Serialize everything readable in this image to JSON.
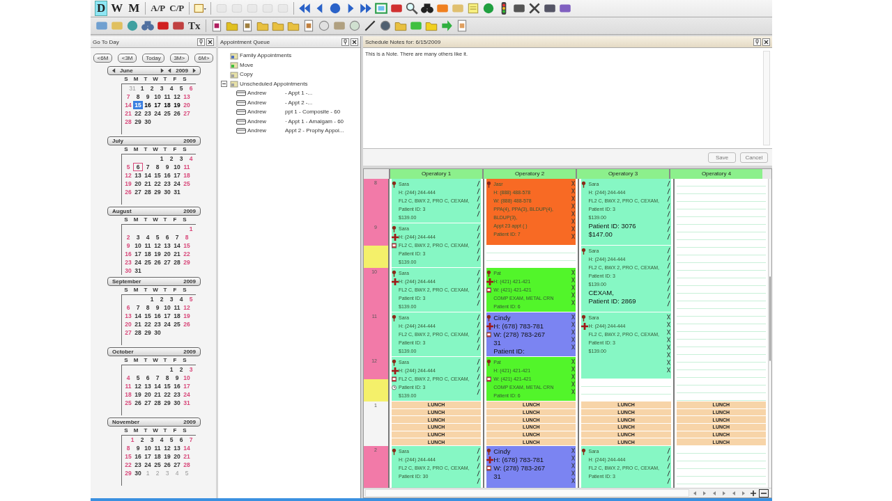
{
  "toolbar": {
    "view_buttons": [
      {
        "label": "D",
        "selected": true
      },
      {
        "label": "W",
        "selected": false
      },
      {
        "label": "M",
        "selected": false
      }
    ],
    "text_buttons": [
      "A/P",
      "C/P"
    ],
    "tx_button": "Tx",
    "edit_tools_disabled": true
  },
  "go_to_day": {
    "title": "Go To Day",
    "jump_buttons": [
      "<6M",
      "<3M",
      "Today",
      "3M>",
      "6M>"
    ],
    "months": [
      {
        "name": "June",
        "year": "2009",
        "nav": true,
        "weekdays": [
          "S",
          "M",
          "T",
          "W",
          "T",
          "F",
          "S"
        ],
        "weeks": [
          [
            {
              "day": "31",
              "outside": true
            },
            "1",
            "2",
            "3",
            "4",
            "5",
            "6"
          ],
          [
            "7",
            "8",
            "9",
            "10",
            "11",
            "12",
            "13"
          ],
          [
            "14",
            {
              "day": "15",
              "selected": true
            },
            {
              "day": "16",
              "bold": true
            },
            {
              "day": "17",
              "bold": true
            },
            {
              "day": "18",
              "bold": true
            },
            {
              "day": "19",
              "bold": true
            },
            "20"
          ],
          [
            "21",
            "22",
            "23",
            "24",
            "25",
            "26",
            "27"
          ],
          [
            "28",
            "29",
            "30"
          ]
        ]
      },
      {
        "name": "July",
        "year": "2009",
        "nav": false,
        "weekdays": [
          "S",
          "M",
          "T",
          "W",
          "T",
          "F",
          "S"
        ],
        "weeks": [
          [
            "1",
            "2",
            "3",
            "4"
          ],
          [
            "5",
            {
              "day": "6",
              "today": true
            },
            "7",
            "8",
            "9",
            "10",
            "11"
          ],
          [
            "12",
            "13",
            "14",
            "15",
            "16",
            "17",
            "18"
          ],
          [
            "19",
            "20",
            "21",
            "22",
            "23",
            "24",
            "25"
          ],
          [
            "26",
            "27",
            "28",
            "29",
            "30",
            "31"
          ]
        ]
      },
      {
        "name": "August",
        "year": "2009",
        "nav": false,
        "weekdays": [
          "S",
          "M",
          "T",
          "W",
          "T",
          "F",
          "S"
        ],
        "weeks": [
          [
            "1"
          ],
          [
            "2",
            "3",
            "4",
            "5",
            "6",
            "7",
            "8"
          ],
          [
            "9",
            "10",
            "11",
            "12",
            "13",
            "14",
            "15"
          ],
          [
            "16",
            "17",
            "18",
            "19",
            "20",
            "21",
            "22"
          ],
          [
            "23",
            "24",
            "25",
            "26",
            "27",
            "28",
            "29"
          ],
          [
            "30",
            "31"
          ]
        ]
      },
      {
        "name": "September",
        "year": "2009",
        "nav": false,
        "weekdays": [
          "S",
          "M",
          "T",
          "W",
          "T",
          "F",
          "S"
        ],
        "weeks": [
          [
            "1",
            "2",
            "3",
            "4",
            "5"
          ],
          [
            "6",
            "7",
            "8",
            "9",
            "10",
            "11",
            "12"
          ],
          [
            "13",
            "14",
            "15",
            "16",
            "17",
            "18",
            "19"
          ],
          [
            "20",
            "21",
            "22",
            "23",
            "24",
            "25",
            "26"
          ],
          [
            "27",
            "28",
            "29",
            "30"
          ]
        ]
      },
      {
        "name": "October",
        "year": "2009",
        "nav": false,
        "weekdays": [
          "S",
          "M",
          "T",
          "W",
          "T",
          "F",
          "S"
        ],
        "weeks": [
          [
            "1",
            "2",
            "3"
          ],
          [
            "4",
            "5",
            "6",
            "7",
            "8",
            "9",
            "10"
          ],
          [
            "11",
            "12",
            "13",
            "14",
            "15",
            "16",
            "17"
          ],
          [
            "18",
            "19",
            "20",
            "21",
            "22",
            "23",
            "24"
          ],
          [
            "25",
            "26",
            "27",
            "28",
            "29",
            "30",
            "31"
          ]
        ]
      },
      {
        "name": "November",
        "year": "2009",
        "nav": false,
        "weekdays": [
          "S",
          "M",
          "T",
          "W",
          "T",
          "F",
          "S"
        ],
        "weeks": [
          [
            "1",
            "2",
            "3",
            "4",
            "5",
            "6",
            "7"
          ],
          [
            "8",
            "9",
            "10",
            "11",
            "12",
            "13",
            "14"
          ],
          [
            "15",
            "16",
            "17",
            "18",
            "19",
            "20",
            "21"
          ],
          [
            "22",
            "23",
            "24",
            "25",
            "26",
            "27",
            "28"
          ],
          [
            "29",
            "30",
            {
              "day": "1",
              "outside": true
            },
            {
              "day": "2",
              "outside": true
            },
            {
              "day": "3",
              "outside": true
            },
            {
              "day": "4",
              "outside": true
            },
            {
              "day": "5",
              "outside": true
            }
          ]
        ]
      }
    ]
  },
  "appointment_queue": {
    "title": "Appointment Queue",
    "items": [
      {
        "label": "Family Appointments"
      },
      {
        "label": "Move"
      },
      {
        "label": "Copy"
      },
      {
        "label": "Unscheduled Appointments",
        "expanded": true,
        "children": [
          {
            "patient": "Andrew",
            "appointment": "- Appt 1 -..."
          },
          {
            "patient": "Andrew",
            "appointment": "- Appt 2 -..."
          },
          {
            "patient": "Andrew",
            "appointment": "ppt 1 - Composite - 60"
          },
          {
            "patient": "Andrew",
            "appointment": "· Appt 1 - Amalgam - 60"
          },
          {
            "patient": "Andrew",
            "appointment": "Appt 2 - Prophy Appoi..."
          }
        ]
      }
    ]
  },
  "schedule_notes": {
    "title": "Schedule Notes for: 6/15/2009",
    "text": "This is a Note.  There are many others like it.",
    "buttons": [
      {
        "label": "Save",
        "disabled": true
      },
      {
        "label": "Cancel",
        "disabled": true
      }
    ]
  },
  "schedule": {
    "time_segments": [
      {
        "color": "#f27aa8"
      },
      {
        "color": "#f4f06a"
      },
      {
        "color": "#f27aa8"
      },
      {
        "color": "#f4f06a"
      },
      {
        "color": "#f4f4f4"
      },
      {
        "color": "#f27aa8"
      }
    ],
    "hours": [
      "8",
      "9",
      "10",
      "11",
      "12",
      "1",
      "2"
    ],
    "operatories": [
      {
        "name": "Operatory 1",
        "blocks": [
          {
            "kind": "appointment",
            "color": "#86f7c4",
            "cross_marks": false,
            "alert": false,
            "note": false,
            "clock": false,
            "large": false,
            "lines": [
              "Sara",
              "H: (244) 244-444",
              "FL2 C, BWX 2, PRO C, CEXAM,",
              "Patient ID: 3",
              "$139.00"
            ]
          },
          {
            "kind": "appointment",
            "color": "#86f7c4",
            "cross_marks": false,
            "alert": true,
            "note": true,
            "clock": false,
            "large": false,
            "lines": [
              "Sara",
              "H: (244) 244-444",
              "FL2 C, BWX 2, PRO C, CEXAM,",
              "Patient ID: 3",
              "$139.00"
            ]
          },
          {
            "kind": "appointment",
            "color": "#86f7c4",
            "cross_marks": false,
            "alert": true,
            "note": false,
            "clock": false,
            "large": false,
            "lines": [
              "Sara",
              "H: (244) 244-444",
              "FL2 C, BWX 2, PRO C, CEXAM,",
              "Patient ID: 3",
              "$139.00"
            ]
          },
          {
            "kind": "appointment",
            "color": "#86f7c4",
            "cross_marks": false,
            "alert": false,
            "note": false,
            "clock": false,
            "large": false,
            "lines": [
              "Sara",
              "H: (244) 244-444",
              "FL2 C, BWX 2, PRO C, CEXAM,",
              "Patient ID: 3",
              "$139.00"
            ]
          },
          {
            "kind": "appointment",
            "color": "#86f7c4",
            "cross_marks": false,
            "alert": true,
            "note": true,
            "clock": true,
            "large": false,
            "lines": [
              "Sara",
              "H: (244) 244-444",
              "FL2 C, BWX 2, PRO C, CEXAM,",
              "Patient ID: 3",
              "$139.00"
            ]
          },
          {
            "kind": "lunch",
            "lines": [
              "LUNCH",
              "LUNCH",
              "LUNCH",
              "LUNCH",
              "LUNCH",
              "LUNCH"
            ]
          },
          {
            "kind": "appointment",
            "color": "#86f7c4",
            "cross_marks": false,
            "alert": false,
            "note": false,
            "clock": false,
            "large": false,
            "lines": [
              "Sara",
              "H: (244) 244-444",
              "FL2 C, BWX 2, PRO C, CEXAM,",
              "Patient ID: 30"
            ]
          }
        ]
      },
      {
        "name": "Operatory 2",
        "blocks": [
          {
            "kind": "appointment",
            "color": "#f86a24",
            "cross_marks": true,
            "alert": false,
            "note": false,
            "clock": false,
            "large": false,
            "lines": [
              "Jasr",
              "H: (888) 488-578",
              "W: (888) 488-578",
              "PPA(4), PPA(3), BLDUP(4), BLDUP(3),",
              "Appt 23 appt ( )",
              "Patient ID: 7"
            ]
          },
          {
            "kind": "empty"
          },
          {
            "kind": "appointment",
            "color": "#52f52a",
            "cross_marks": true,
            "alert": true,
            "note": true,
            "clock": false,
            "large": false,
            "lines": [
              "Pat",
              "H: (421) 421-421",
              "W: (421) 421-421",
              "COMP EXAM, METAL CRN",
              "Patient ID: 6"
            ]
          },
          {
            "kind": "appointment",
            "color": "#7b84f2",
            "cross_marks": true,
            "alert": true,
            "note": true,
            "clock": false,
            "large": true,
            "lines": [
              "Cindy",
              "H: (678) 783-781",
              "W: (278) 783-267",
              "31",
              "Patient ID:"
            ]
          },
          {
            "kind": "appointment",
            "color": "#52f52a",
            "cross_marks": true,
            "alert": false,
            "note": true,
            "clock": false,
            "large": false,
            "lines": [
              "Pat",
              "H: (421) 421-421",
              "W: (421) 421-421",
              "COMP EXAM, METAL CRN",
              "Patient ID: 6"
            ]
          },
          {
            "kind": "lunch",
            "lines": [
              "LUNCH",
              "LUNCH",
              "LUNCH",
              "LUNCH",
              "LUNCH",
              "LUNCH"
            ]
          },
          {
            "kind": "appointment",
            "color": "#7b84f2",
            "cross_marks": true,
            "alert": true,
            "note": true,
            "clock": false,
            "large": true,
            "lines": [
              "Cindy",
              "H: (678) 783-781",
              "W: (278) 783-267",
              "31"
            ]
          }
        ]
      },
      {
        "name": "Operatory 3",
        "blocks": [
          {
            "kind": "appointment",
            "color": "#86f7c4",
            "cross_marks": false,
            "alert": false,
            "note": false,
            "clock": false,
            "large": false,
            "lines": [
              "Sara",
              "H: (244) 244-444",
              "FL2 C, BWX 2, PRO C, CEXAM,",
              "Patient ID: 3",
              "$139.00"
            ],
            "extra_lines": [
              "Patient ID: 3076",
              "$147.00"
            ]
          },
          {
            "kind": "appointment",
            "color": "#86f7c4",
            "cross_marks": false,
            "alert": false,
            "note": false,
            "clock": false,
            "large": false,
            "lines": [
              "Sara",
              "H: (244) 244-444",
              "FL2 C, BWX 2, PRO C, CEXAM,",
              "Patient ID: 3",
              "$139.00"
            ],
            "extra_lines": [
              "CEXAM,",
              "Patient ID: 2869"
            ]
          },
          {
            "kind": "appointment",
            "color": "#86f7c4",
            "cross_marks": true,
            "alert": true,
            "note": false,
            "clock": false,
            "large": false,
            "lines": [
              "Sara",
              "H: (244) 244-444",
              "FL2 C, BWX 2, PRO C, CEXAM,",
              "Patient ID: 3",
              "$139.00"
            ]
          },
          {
            "kind": "empty"
          },
          {
            "kind": "lunch",
            "lines": [
              "LUNCH",
              "LUNCH",
              "LUNCH",
              "LUNCH",
              "LUNCH",
              "LUNCH"
            ]
          },
          {
            "kind": "appointment",
            "color": "#86f7c4",
            "cross_marks": false,
            "alert": false,
            "note": false,
            "clock": false,
            "large": false,
            "lines": [
              "Sara",
              "H: (244) 244-444",
              "FL2 C, BWX 2, PRO C, CEXAM,",
              "Patient ID: 3"
            ]
          }
        ]
      },
      {
        "name": "Operatory 4",
        "blocks": [
          {
            "kind": "empty"
          },
          {
            "kind": "lunch",
            "lines": [
              "LUNCH",
              "LUNCH",
              "LUNCH",
              "LUNCH",
              "LUNCH",
              "LUNCH"
            ]
          },
          {
            "kind": "empty"
          }
        ]
      }
    ]
  }
}
